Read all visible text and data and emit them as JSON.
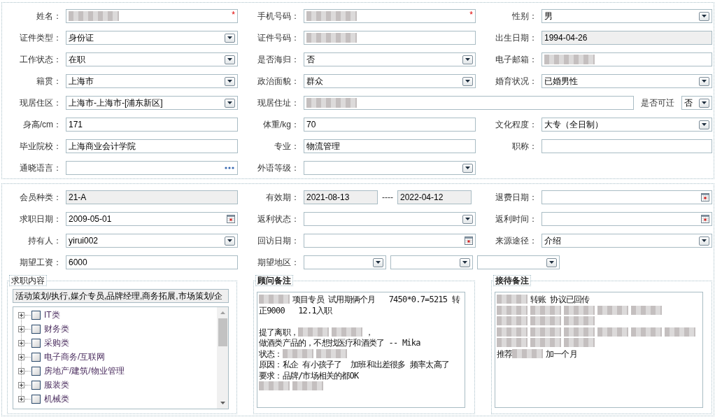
{
  "basic_info": {
    "rows": [
      [
        {
          "kind": "normal",
          "label": "姓名：",
          "parts": [
            {
              "kind": "text",
              "readonly": false,
              "redacted": true,
              "required_mark": "*"
            }
          ]
        },
        {
          "kind": "normal",
          "label": "手机号码：",
          "parts": [
            {
              "kind": "text",
              "readonly": false,
              "redacted": true,
              "required_mark": "*"
            }
          ]
        },
        {
          "kind": "normal",
          "label": "性别：",
          "parts": [
            {
              "kind": "select",
              "value": "男",
              "readonly": false,
              "redacted": false
            }
          ]
        }
      ],
      [
        {
          "kind": "normal",
          "label": "证件类型：",
          "parts": [
            {
              "kind": "select",
              "value": "身份证",
              "readonly": false,
              "redacted": false
            }
          ]
        },
        {
          "kind": "normal",
          "label": "证件号码：",
          "parts": [
            {
              "kind": "text",
              "readonly": false,
              "redacted": true
            }
          ]
        },
        {
          "kind": "normal",
          "label": "出生日期：",
          "parts": [
            {
              "kind": "text",
              "value": "1994-04-26",
              "readonly": true,
              "redacted": false
            }
          ]
        }
      ],
      [
        {
          "kind": "normal",
          "label": "工作状态：",
          "parts": [
            {
              "kind": "select",
              "value": "在职",
              "readonly": false,
              "redacted": false
            }
          ]
        },
        {
          "kind": "normal",
          "label": "是否海归：",
          "parts": [
            {
              "kind": "select",
              "value": "否",
              "readonly": false,
              "redacted": false
            }
          ]
        },
        {
          "kind": "normal",
          "label": "电子邮箱：",
          "parts": [
            {
              "kind": "text",
              "readonly": false,
              "redacted": true
            }
          ]
        }
      ],
      [
        {
          "kind": "normal",
          "label": "籍贯：",
          "parts": [
            {
              "kind": "select",
              "value": "上海市",
              "readonly": false,
              "redacted": false
            }
          ]
        },
        {
          "kind": "normal",
          "label": "政治面貌：",
          "parts": [
            {
              "kind": "select",
              "value": "群众",
              "readonly": false,
              "redacted": false
            }
          ]
        },
        {
          "kind": "normal",
          "label": "婚育状况：",
          "parts": [
            {
              "kind": "select",
              "value": "已婚男性",
              "readonly": false,
              "redacted": false
            }
          ]
        }
      ],
      [
        {
          "kind": "normal",
          "label": "现居住区：",
          "parts": [
            {
              "kind": "select",
              "value": "上海市-上海市-[浦东新区]",
              "readonly": false,
              "redacted": false
            }
          ]
        },
        {
          "kind": "wide",
          "label": "现居住址：",
          "parts": [
            {
              "kind": "text",
              "readonly": false,
              "redacted": true
            },
            {
              "kind": "label",
              "text": "是否可迁"
            },
            {
              "kind": "select",
              "value": "否",
              "readonly": false,
              "redacted": false
            }
          ]
        }
      ],
      [
        {
          "kind": "normal",
          "label": "身高/cm：",
          "parts": [
            {
              "kind": "text",
              "value": "171",
              "readonly": false,
              "redacted": false
            }
          ]
        },
        {
          "kind": "normal",
          "label": "体重/kg：",
          "parts": [
            {
              "kind": "text",
              "value": "70",
              "readonly": false,
              "redacted": false
            }
          ]
        },
        {
          "kind": "normal",
          "label": "文化程度：",
          "parts": [
            {
              "kind": "select",
              "value": "大专（全日制）",
              "readonly": false,
              "redacted": false
            }
          ]
        }
      ],
      [
        {
          "kind": "normal",
          "label": "毕业院校：",
          "parts": [
            {
              "kind": "text",
              "value": "上海商业会计学院",
              "readonly": false,
              "redacted": false
            }
          ]
        },
        {
          "kind": "normal",
          "label": "专业：",
          "parts": [
            {
              "kind": "text",
              "value": "物流管理",
              "readonly": false,
              "redacted": false
            }
          ]
        },
        {
          "kind": "normal",
          "label": "职称：",
          "parts": [
            {
              "kind": "text",
              "readonly": false,
              "redacted": false
            }
          ]
        }
      ],
      [
        {
          "kind": "normal",
          "label": "通晓语言：",
          "parts": [
            {
              "kind": "picker",
              "readonly": false,
              "redacted": false
            }
          ]
        },
        {
          "kind": "normal",
          "label": "外语等级：",
          "parts": [
            {
              "kind": "select",
              "readonly": false,
              "redacted": false
            }
          ]
        }
      ]
    ]
  },
  "membership": {
    "rows": [
      [
        {
          "kind": "normal",
          "label": "会员种类：",
          "parts": [
            {
              "kind": "text",
              "value": "21-A",
              "readonly": true,
              "redacted": false
            }
          ]
        },
        {
          "kind": "normal",
          "label": "有效期：",
          "parts": [
            {
              "kind": "text",
              "value": "2021-08-13",
              "readonly": true,
              "redacted": false
            },
            {
              "kind": "separator",
              "text": "----"
            },
            {
              "kind": "text",
              "value": "2022-04-12",
              "readonly": true,
              "redacted": false
            }
          ]
        },
        {
          "kind": "normal",
          "label": "退费日期：",
          "parts": [
            {
              "kind": "date",
              "readonly": false,
              "redacted": false
            }
          ]
        }
      ],
      [
        {
          "kind": "normal",
          "label": "求职日期：",
          "parts": [
            {
              "kind": "date",
              "value": "2009-05-01",
              "readonly": false,
              "redacted": false
            }
          ]
        },
        {
          "kind": "normal",
          "label": "返利状态：",
          "parts": [
            {
              "kind": "select",
              "readonly": false,
              "redacted": false
            }
          ]
        },
        {
          "kind": "normal",
          "label": "返利时间：",
          "parts": [
            {
              "kind": "date",
              "readonly": false,
              "redacted": false
            }
          ]
        }
      ],
      [
        {
          "kind": "normal",
          "label": "持有人：",
          "parts": [
            {
              "kind": "select",
              "value": "yirui002",
              "readonly": false,
              "redacted": false
            }
          ]
        },
        {
          "kind": "normal",
          "label": "回访日期：",
          "parts": [
            {
              "kind": "date",
              "readonly": false,
              "redacted": false
            }
          ]
        },
        {
          "kind": "normal",
          "label": "来源途径：",
          "parts": [
            {
              "kind": "select",
              "value": "介绍",
              "readonly": false,
              "redacted": false
            }
          ]
        }
      ],
      [
        {
          "kind": "normal",
          "label": "期望工资：",
          "parts": [
            {
              "kind": "text",
              "value": "6000",
              "readonly": false,
              "redacted": false
            }
          ]
        },
        {
          "kind": "normal",
          "label": "期望地区：",
          "parts": [
            {
              "kind": "select",
              "readonly": false,
              "redacted": false
            },
            {
              "kind": "select",
              "readonly": false,
              "redacted": false
            },
            {
              "kind": "select",
              "readonly": false,
              "redacted": false
            }
          ]
        }
      ]
    ]
  },
  "panels": [
    {
      "kind": "tree",
      "legend": "求职内容",
      "summary": {
        "value": "活动策划/执行,媒介专员,品牌经理,商务拓展,市场策划/企",
        "readonly": true
      },
      "items": [
        {
          "label": "IT类",
          "expanded": false,
          "checked": false
        },
        {
          "label": "财务类",
          "expanded": false,
          "checked": false
        },
        {
          "label": "采购类",
          "expanded": false,
          "checked": false
        },
        {
          "label": "电子商务/互联网",
          "expanded": false,
          "checked": false
        },
        {
          "label": "房地产/建筑/物业管理",
          "expanded": false,
          "checked": false
        },
        {
          "label": "服装类",
          "expanded": false,
          "checked": false
        },
        {
          "label": "机械类",
          "expanded": false,
          "checked": false
        }
      ]
    },
    {
      "kind": "notes",
      "legend": "顾问备注",
      "lines": [
        {
          "kind": "text",
          "parts": [
            {
              "kind": "redacted"
            },
            {
              "kind": "text",
              "text": "项目专员 试用期俩个月   7450*0.7=5215 转"
            }
          ]
        },
        {
          "kind": "text",
          "parts": [
            {
              "kind": "text",
              "text": "正9000   12.1入职"
            }
          ]
        },
        {
          "kind": "blank"
        },
        {
          "kind": "text",
          "parts": [
            {
              "kind": "text",
              "text": "提了离职，"
            },
            {
              "kind": "redacted"
            },
            {
              "kind": "redacted"
            },
            {
              "kind": "text",
              "text": "，"
            }
          ]
        },
        {
          "kind": "text",
          "parts": [
            {
              "kind": "text",
              "text": "做酒类产品的，不想找医疗和酒类了 -- Mika"
            }
          ]
        },
        {
          "kind": "text",
          "parts": [
            {
              "kind": "text",
              "text": "状态："
            },
            {
              "kind": "redacted"
            },
            {
              "kind": "redacted"
            }
          ]
        },
        {
          "kind": "text",
          "parts": [
            {
              "kind": "text",
              "text": "原因：私企 有小孩子了  加班和出差很多 频率太高了"
            }
          ]
        },
        {
          "kind": "text",
          "parts": [
            {
              "kind": "text",
              "text": "要求：品牌/市场相关的都OK"
            }
          ]
        },
        {
          "kind": "text",
          "parts": [
            {
              "kind": "redacted"
            },
            {
              "kind": "redacted"
            }
          ]
        }
      ]
    },
    {
      "kind": "notes",
      "legend": "接待备注",
      "lines": [
        {
          "kind": "text",
          "parts": [
            {
              "kind": "redacted"
            },
            {
              "kind": "text",
              "text": "转账 协议已回传"
            }
          ]
        },
        {
          "kind": "text",
          "parts": [
            {
              "kind": "redacted"
            },
            {
              "kind": "redacted"
            },
            {
              "kind": "redacted"
            },
            {
              "kind": "redacted"
            },
            {
              "kind": "redacted"
            }
          ]
        },
        {
          "kind": "text",
          "parts": [
            {
              "kind": "redacted"
            },
            {
              "kind": "redacted"
            },
            {
              "kind": "redacted"
            }
          ]
        },
        {
          "kind": "text",
          "parts": [
            {
              "kind": "redacted"
            },
            {
              "kind": "redacted"
            },
            {
              "kind": "redacted"
            },
            {
              "kind": "redacted"
            },
            {
              "kind": "redacted"
            },
            {
              "kind": "redacted"
            }
          ]
        },
        {
          "kind": "text",
          "parts": [
            {
              "kind": "redacted"
            },
            {
              "kind": "redacted"
            },
            {
              "kind": "redacted"
            }
          ]
        },
        {
          "kind": "text",
          "parts": [
            {
              "kind": "text",
              "text": "推荐"
            },
            {
              "kind": "redacted"
            },
            {
              "kind": "text",
              "text": "加一个月"
            }
          ]
        }
      ]
    }
  ]
}
